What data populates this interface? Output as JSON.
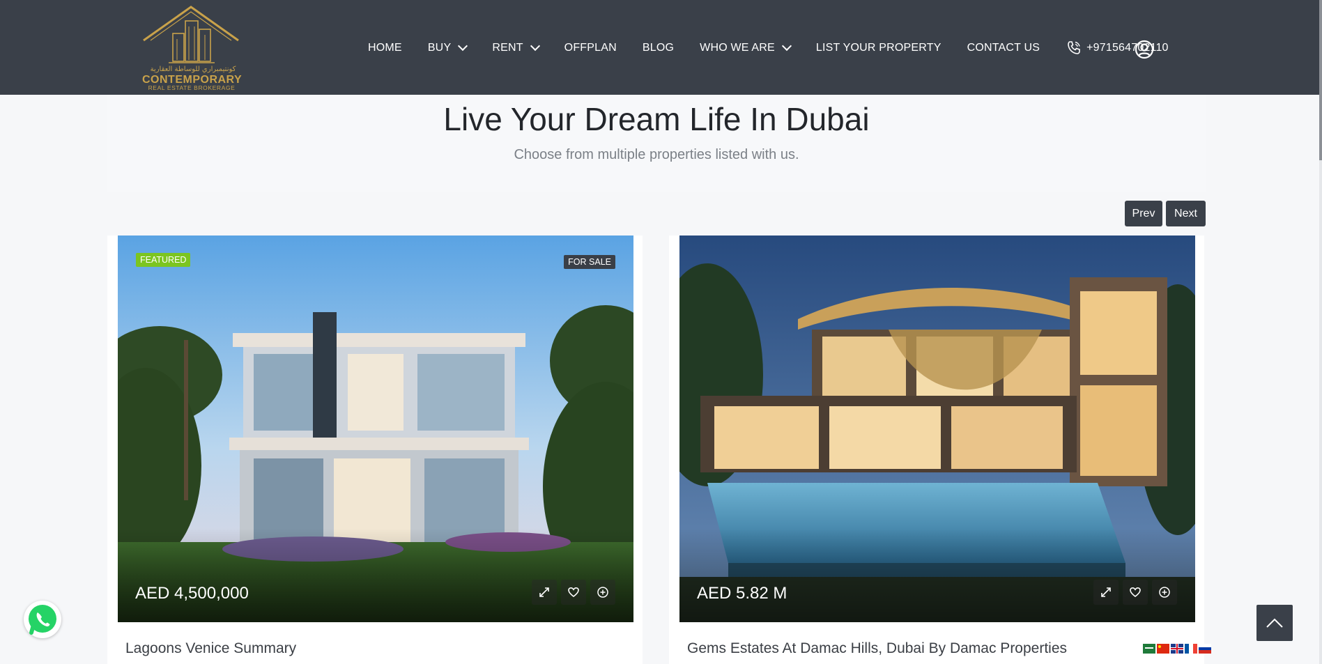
{
  "header": {
    "logo": {
      "arabic_name": "كونتيمبراري للوساطة العقارية",
      "brand": "CONTEMPORARY",
      "tagline": "REAL ESTATE BROKERAGE"
    },
    "nav": [
      {
        "label": "HOME"
      },
      {
        "label": "BUY"
      },
      {
        "label": "RENT"
      },
      {
        "label": "OFFPLAN"
      },
      {
        "label": "BLOG"
      },
      {
        "label": "WHO WE ARE"
      },
      {
        "label": "LIST YOUR PROPERTY"
      },
      {
        "label": "CONTACT US"
      }
    ],
    "phone": "+971564702110",
    "icons": [
      "phone-icon",
      "user-account-icon",
      "chevron-down-icon"
    ]
  },
  "section": {
    "title": "Live Your Dream Life In Dubai",
    "subtitle": "Choose from multiple properties listed with us.",
    "prev_label": "Prev",
    "next_label": "Next"
  },
  "listings": [
    {
      "featured_label": "FEATURED",
      "status_label": "FOR SALE",
      "price": "AED 4,500,000",
      "title": "Lagoons Venice Summary"
    },
    {
      "price": "AED 5.82 M",
      "title": "Gems Estates At Damac Hills, Dubai By Damac Properties"
    }
  ],
  "languages": [
    "ar",
    "zh",
    "en",
    "fr",
    "ru"
  ],
  "colors": {
    "header_bg": "#3a4049",
    "brand_gold": "#c9a24a",
    "featured_green": "#7cc520",
    "page_bg": "#f6f7f9",
    "whatsapp_green": "#25d366"
  }
}
